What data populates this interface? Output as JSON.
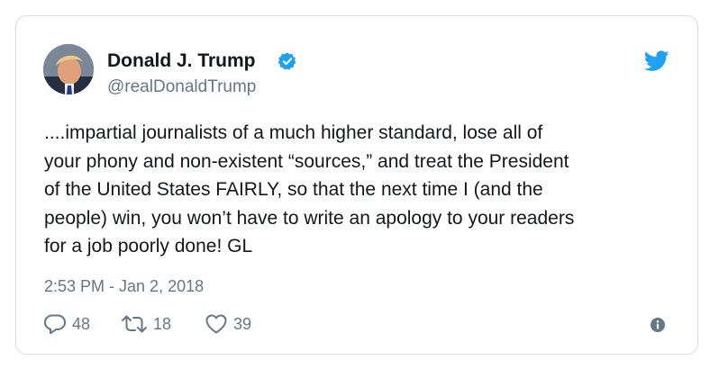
{
  "tweet": {
    "author": {
      "name": "Donald J. Trump",
      "handle": "@realDonaldTrump",
      "verified": true
    },
    "text_lines": [
      "....impartial journalists of a much higher standard, lose all of",
      "your phony and non-existent “sources,” and treat the President",
      "of the United States FAIRLY, so that the next time I (and the",
      "people) win, you won’t have to write an apology to your readers",
      "for a job poorly done! GL"
    ],
    "timestamp": "2:53 PM - Jan 2, 2018",
    "actions": {
      "replies": "48",
      "retweets": "18",
      "likes": "39"
    }
  },
  "colors": {
    "twitter_blue": "#1da1f2",
    "text_primary": "#14171a",
    "text_secondary": "#657786",
    "border": "#d8dde2"
  },
  "icons": [
    "verified-badge-icon",
    "twitter-bird-icon",
    "reply-icon",
    "retweet-icon",
    "like-heart-icon",
    "info-icon"
  ]
}
